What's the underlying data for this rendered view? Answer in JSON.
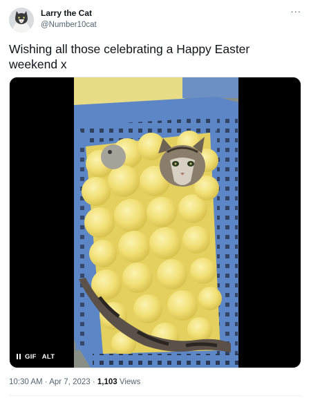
{
  "author": {
    "display_name": "Larry the Cat",
    "handle": "@Number10cat",
    "avatar_icon": "cat-avatar-icon"
  },
  "more_icon": "ellipsis-icon",
  "more_glyph": "···",
  "tweet": {
    "text": "Wishing all those celebrating a Happy Easter\nweekend x"
  },
  "media": {
    "type": "gif",
    "pause_icon": "pause-icon",
    "gif_label": "GIF",
    "alt_label": "ALT"
  },
  "meta": {
    "time": "10:30 AM",
    "separator": " · ",
    "date": "Apr 7, 2023",
    "views_count": "1,103",
    "views_label": " Views"
  },
  "colors": {
    "text_primary": "#0f1419",
    "text_secondary": "#536471",
    "basket": "#5d86c6",
    "chick": "#f3e27a"
  }
}
